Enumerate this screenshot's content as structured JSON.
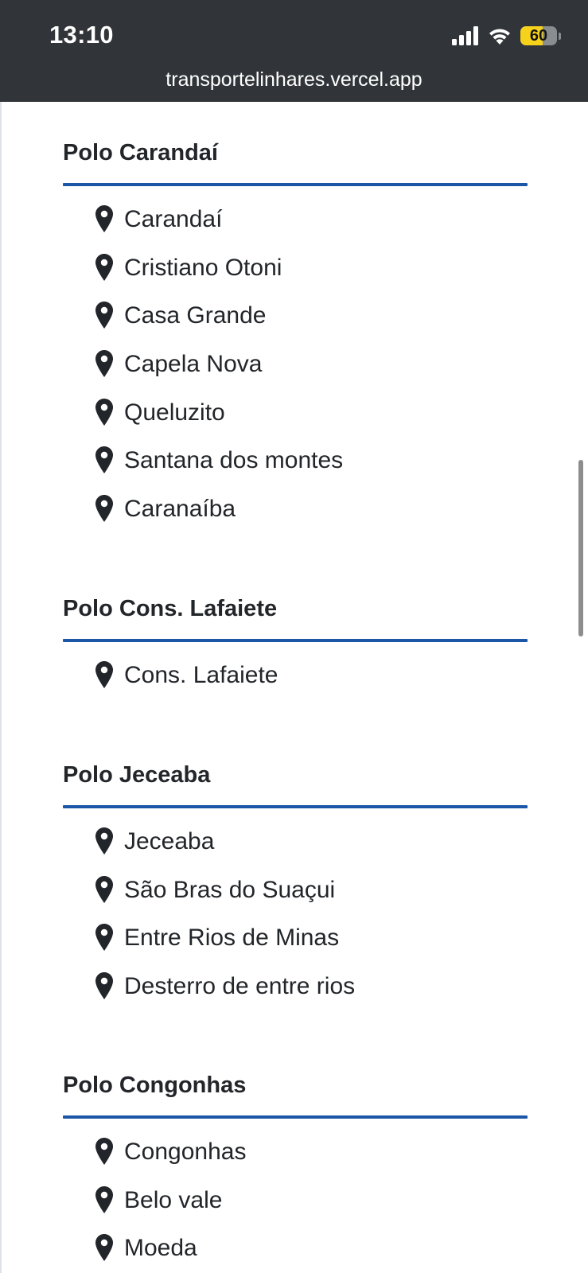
{
  "status_bar": {
    "time": "13:10",
    "battery_level": "60",
    "battery_fraction": 0.6,
    "url": "transportelinhares.vercel.app"
  },
  "colors": {
    "status_bar_bg": "#313539",
    "accent_rule": "#1b57a6",
    "text": "#222529",
    "battery_fill": "#f7d21b"
  },
  "polos": [
    {
      "title": "Polo Carandaí",
      "cities": [
        "Carandaí",
        "Cristiano Otoni",
        "Casa Grande",
        "Capela Nova",
        "Queluzito",
        "Santana dos montes",
        "Caranaíba"
      ]
    },
    {
      "title": "Polo Cons. Lafaiete",
      "cities": [
        "Cons. Lafaiete"
      ]
    },
    {
      "title": "Polo Jeceaba",
      "cities": [
        "Jeceaba",
        "São Bras do Suaçui",
        "Entre Rios de Minas",
        "Desterro de entre rios"
      ]
    },
    {
      "title": "Polo Congonhas",
      "cities": [
        "Congonhas",
        "Belo vale",
        "Moeda"
      ]
    }
  ],
  "icons": {
    "city_marker": "map-pin-icon",
    "signal": "cellular-signal-icon",
    "wifi": "wifi-icon",
    "battery": "battery-icon"
  }
}
